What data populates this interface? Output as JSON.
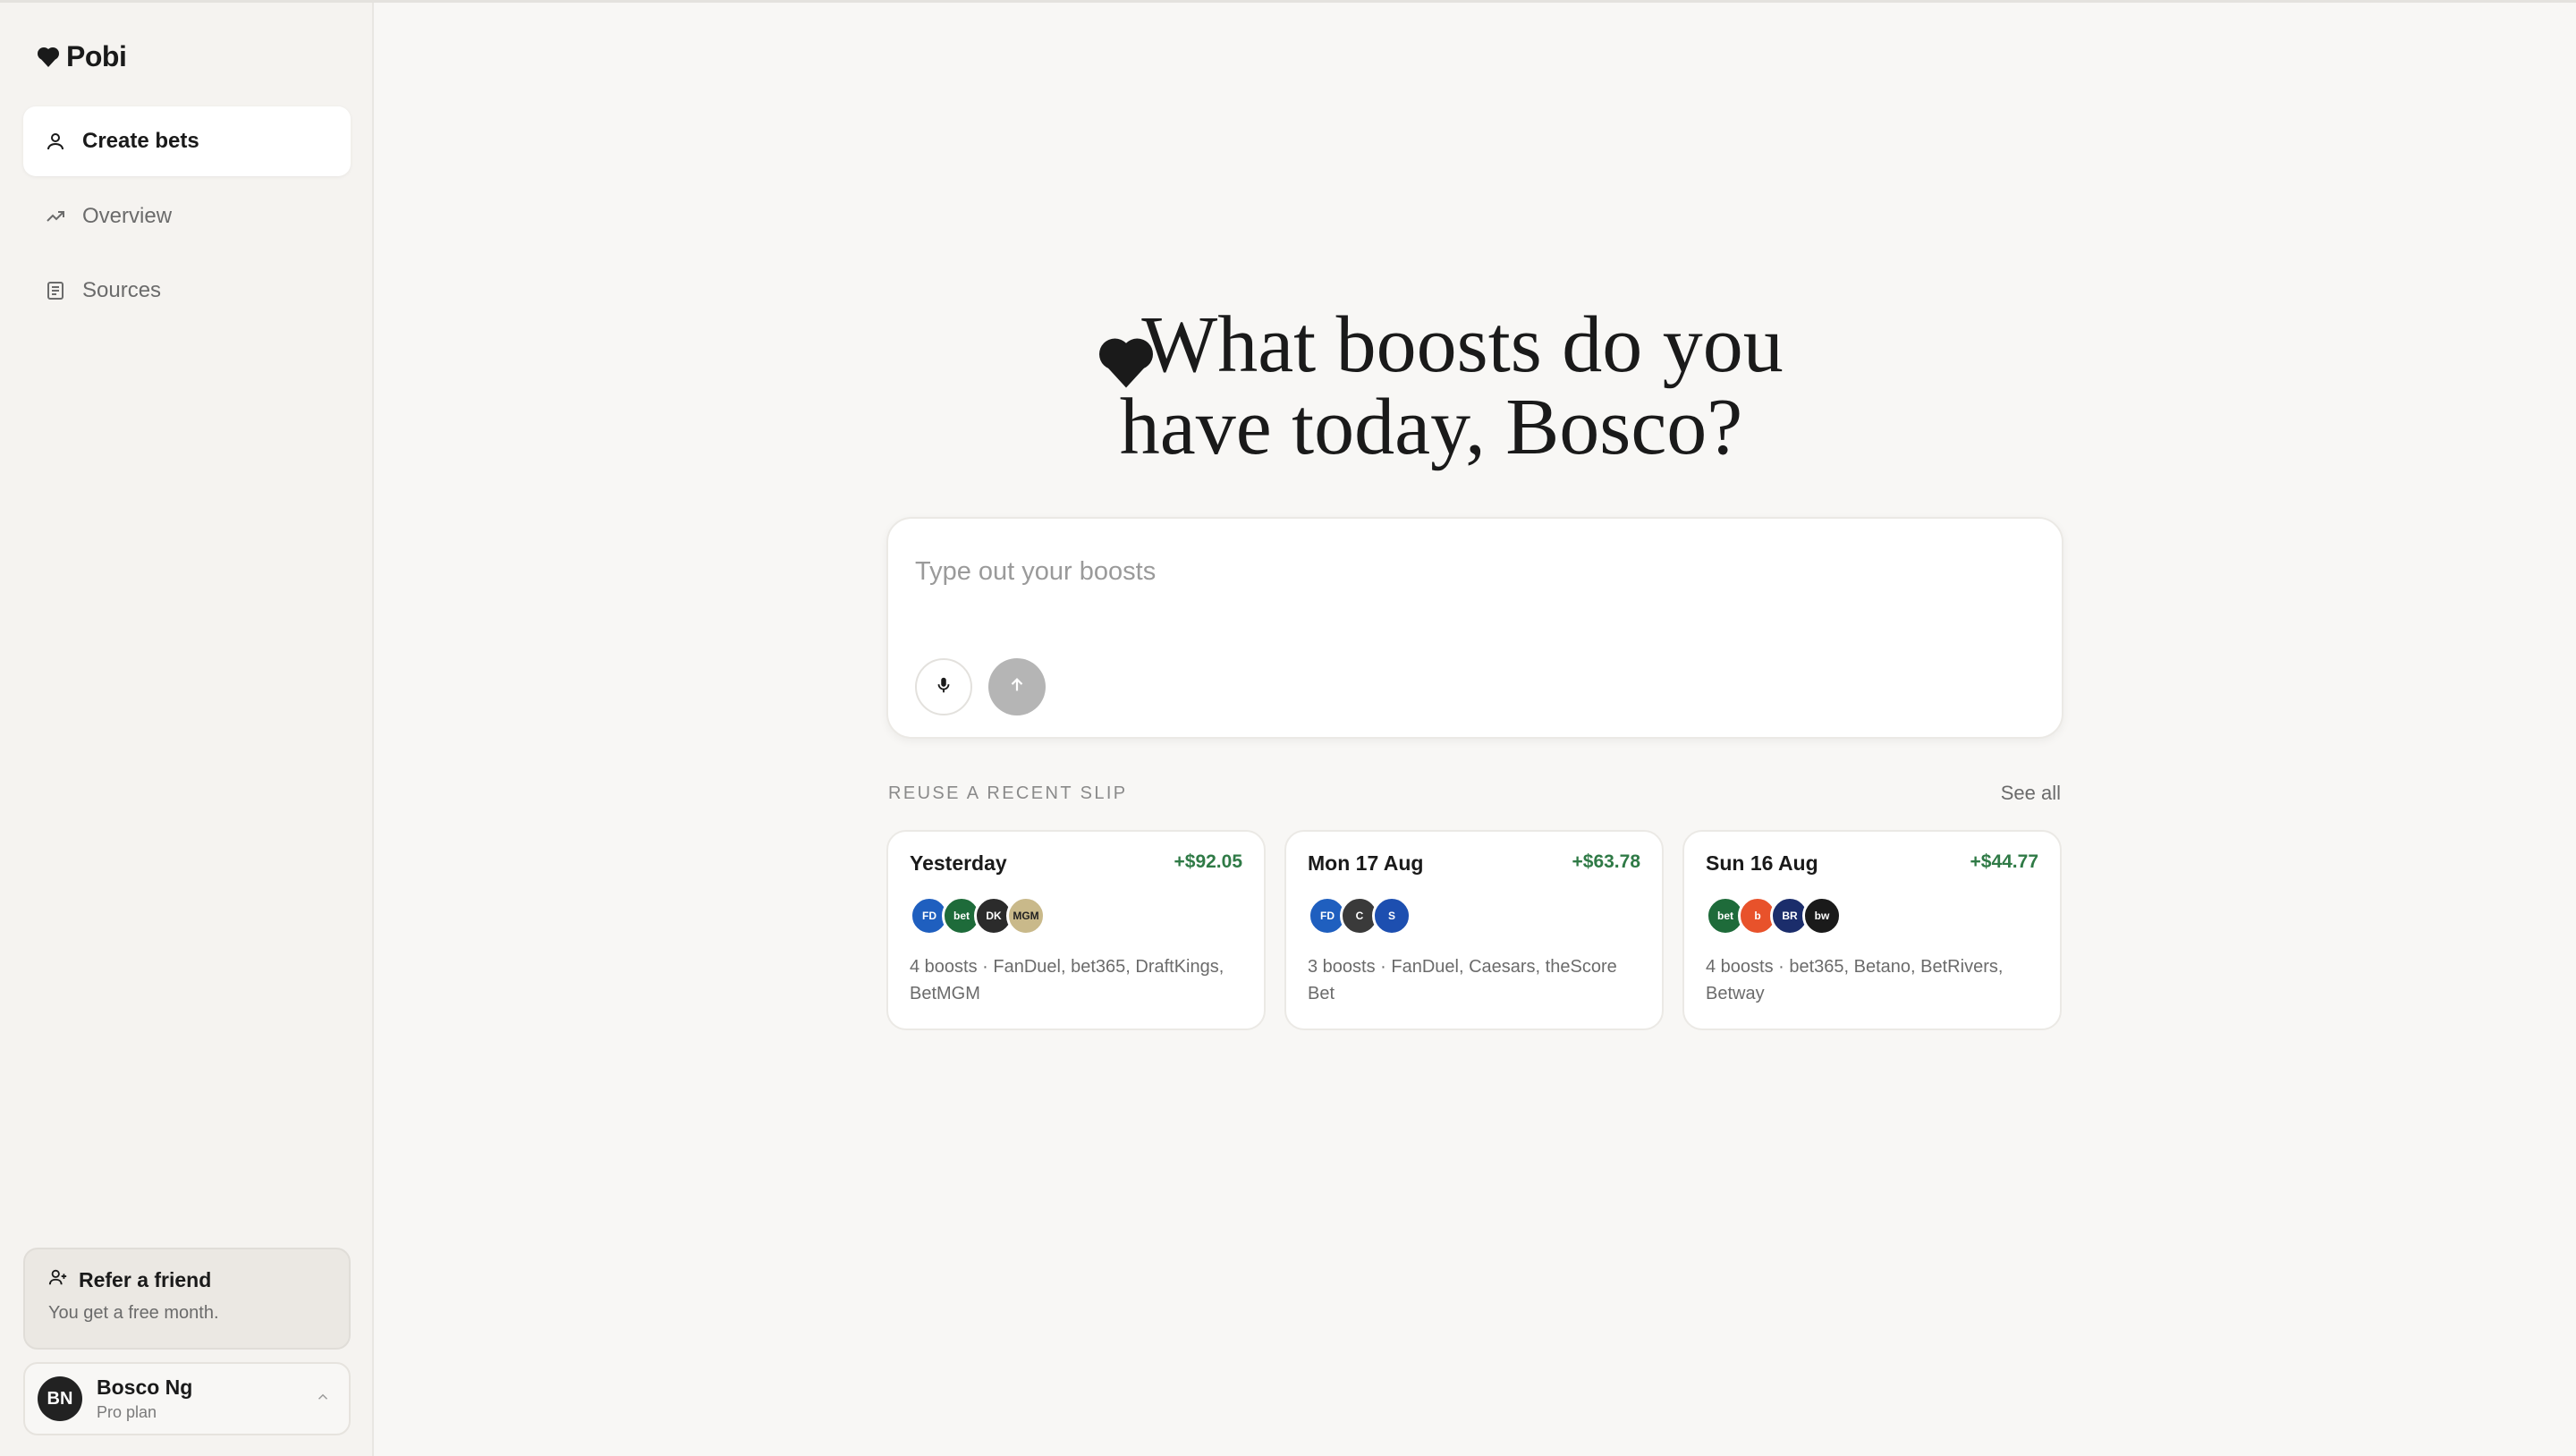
{
  "app": {
    "name": "Pobi"
  },
  "nav": {
    "items": [
      {
        "label": "Create bets",
        "icon": "user-icon",
        "active": true
      },
      {
        "label": "Overview",
        "icon": "trending-up-icon",
        "active": false
      },
      {
        "label": "Sources",
        "icon": "document-icon",
        "active": false
      }
    ]
  },
  "refer": {
    "title": "Refer a friend",
    "subtitle": "You get a free month."
  },
  "account": {
    "initials": "BN",
    "name": "Bosco Ng",
    "plan": "Pro plan"
  },
  "hero": {
    "line1": "What boosts do you",
    "line2": "have today, Bosco?"
  },
  "composer": {
    "placeholder": "Type out your boosts",
    "value": ""
  },
  "recent": {
    "label": "REUSE A RECENT SLIP",
    "see_all": "See all",
    "slips": [
      {
        "date": "Yesterday",
        "amount": "+$92.05",
        "desc": "4 boosts · FanDuel, bet365, DraftKings, BetMGM",
        "logos": [
          {
            "name": "fanduel-logo",
            "text": "FD",
            "color": "#1f5fbf"
          },
          {
            "name": "bet365-logo",
            "text": "bet",
            "color": "#1e6b3a"
          },
          {
            "name": "draftkings-logo",
            "text": "DK",
            "color": "#2b2b2b"
          },
          {
            "name": "betmgm-logo",
            "text": "MGM",
            "color": "#c9b98a"
          }
        ]
      },
      {
        "date": "Mon 17 Aug",
        "amount": "+$63.78",
        "desc": "3 boosts · FanDuel, Caesars, theScore Bet",
        "logos": [
          {
            "name": "fanduel-logo",
            "text": "FD",
            "color": "#1f5fbf"
          },
          {
            "name": "caesars-logo",
            "text": "C",
            "color": "#3a3a3a"
          },
          {
            "name": "thescore-bet-logo",
            "text": "S",
            "color": "#1d4fb0"
          }
        ]
      },
      {
        "date": "Sun 16 Aug",
        "amount": "+$44.77",
        "desc": "4 boosts · bet365, Betano, BetRivers, Betway",
        "logos": [
          {
            "name": "bet365-logo",
            "text": "bet",
            "color": "#1e6b3a"
          },
          {
            "name": "betano-logo",
            "text": "b",
            "color": "#e8522b"
          },
          {
            "name": "betrivers-logo",
            "text": "BR",
            "color": "#1b2d6b"
          },
          {
            "name": "betway-logo",
            "text": "bw",
            "color": "#1a1a1a"
          }
        ]
      }
    ]
  },
  "colors": {
    "accent_positive": "#2f7a46",
    "background": "#f8f7f5"
  }
}
